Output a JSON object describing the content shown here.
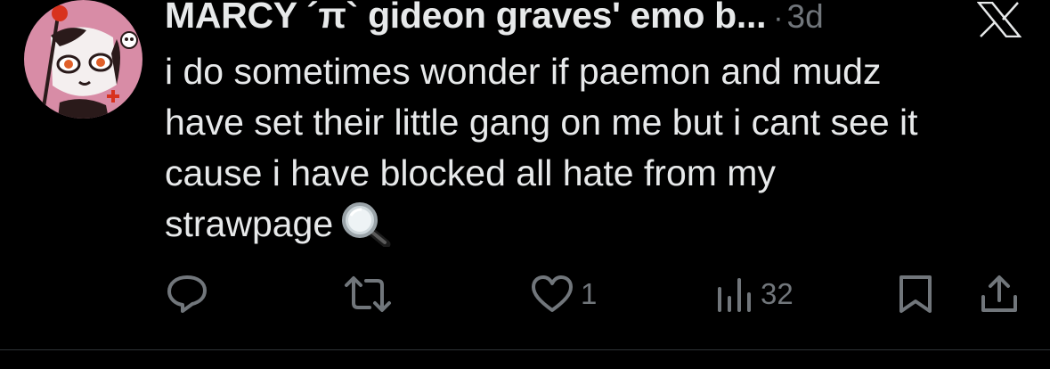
{
  "tweet": {
    "display_name": "MARCY ´π` gideon graves' emo b...",
    "separator": "·",
    "timestamp": "3d",
    "text_lines": [
      "i do sometimes wonder if paemon and mudz",
      "have set their little gang on me but i cant see it",
      "cause i have blocked all hate from my",
      "strawpage"
    ],
    "trailing_emoji": "magnifying-glass-emoji",
    "avatar": "avatar-pink-clown-character"
  },
  "actions": {
    "reply": {
      "icon": "reply-icon"
    },
    "repost": {
      "icon": "repost-icon"
    },
    "like": {
      "icon": "heart-icon",
      "count": "1"
    },
    "views": {
      "icon": "views-bar-chart-icon",
      "count": "32"
    },
    "bookmark": {
      "icon": "bookmark-icon"
    },
    "share": {
      "icon": "share-icon"
    }
  },
  "brand": {
    "logo": "x-logo-icon"
  },
  "colors": {
    "background": "#000000",
    "text_primary": "#e7e9ea",
    "text_secondary": "#71767b",
    "avatar_bg": "#d88ca6"
  }
}
